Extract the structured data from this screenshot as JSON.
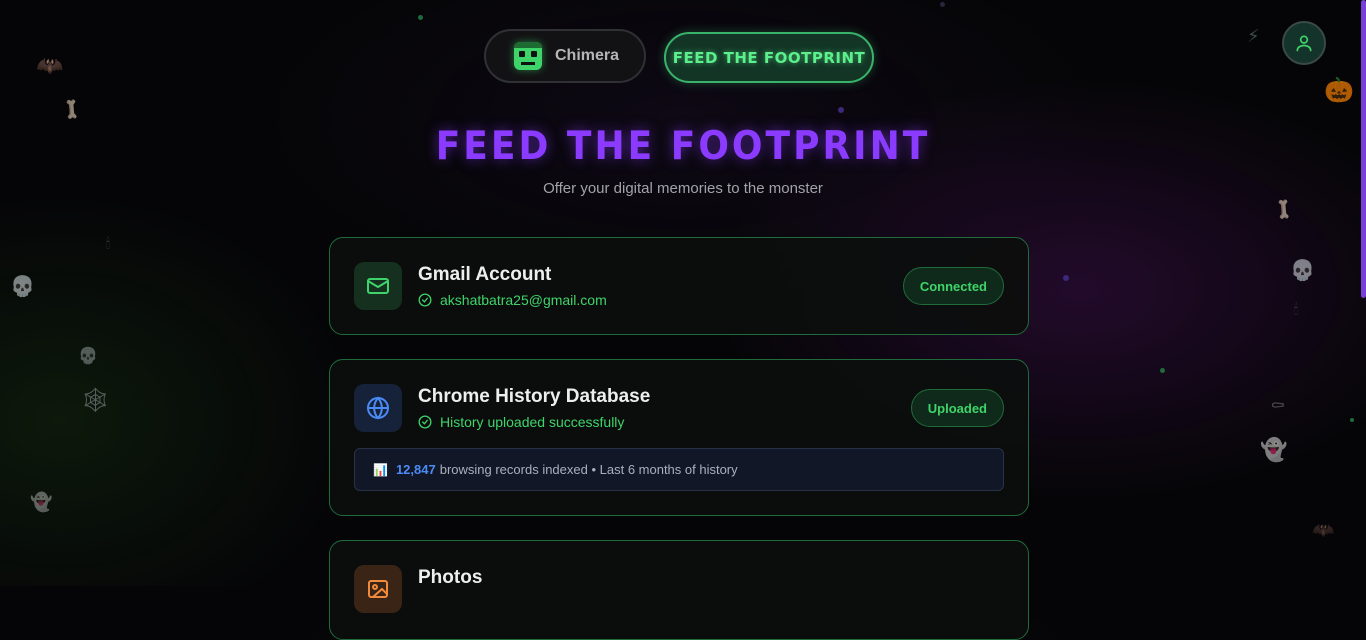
{
  "nav": {
    "brand_label": "Chimera",
    "feed_button_label": "FEED THE FOOTPRINT"
  },
  "header": {
    "title": "FEED THE FOOTPRINT",
    "subtitle": "Offer your digital memories to the monster"
  },
  "cards": {
    "gmail": {
      "title": "Gmail Account",
      "status_text": "akshatbatra25@gmail.com",
      "badge": "Connected",
      "icon": "mail-icon"
    },
    "chrome": {
      "title": "Chrome History Database",
      "status_text": "History uploaded successfully",
      "badge": "Uploaded",
      "icon": "globe-icon",
      "stat_icon": "📊",
      "stat_count": "12,847",
      "stat_text": "browsing records indexed • Last 6 months of history"
    },
    "photos": {
      "title": "Photos",
      "icon": "image-icon"
    }
  },
  "colors": {
    "accent_green": "#3fd46a",
    "accent_purple": "#8a3bff",
    "stat_blue": "#4b8bf5"
  }
}
